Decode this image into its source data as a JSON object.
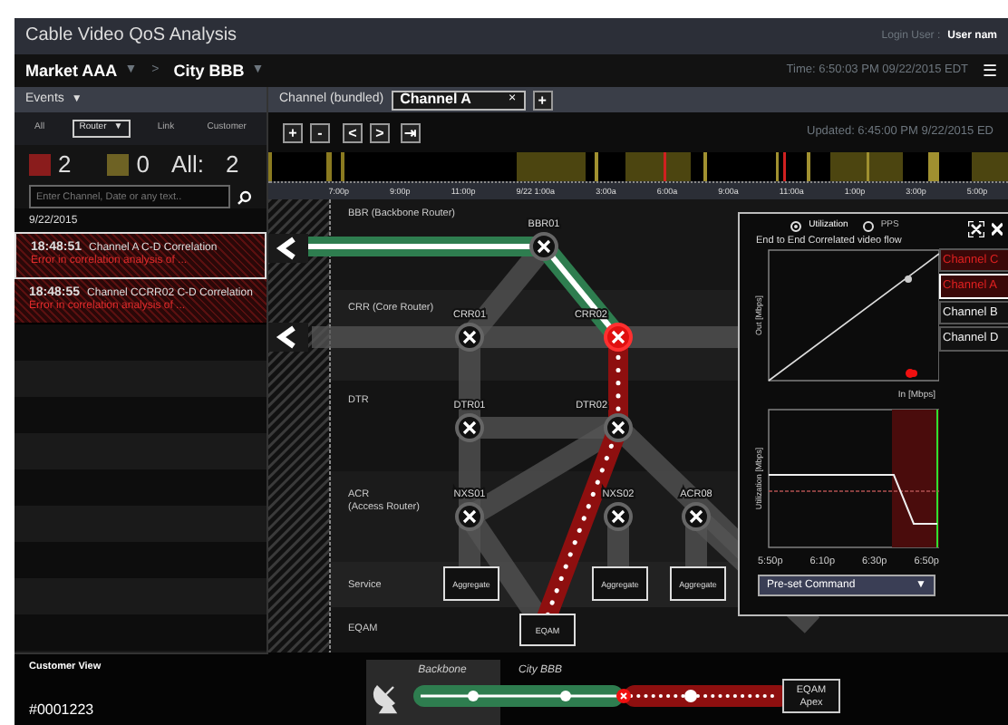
{
  "app_title": "Cable Video QoS Analysis",
  "login": {
    "label": "Login User :",
    "user": "User nam"
  },
  "breadcrumb": [
    {
      "label": "Market AAA",
      "caret": "▼"
    },
    {
      "label": "City BBB",
      "caret": "▼"
    }
  ],
  "breadcrumb_separator": ">",
  "time": "Time: 6:50:03 PM 09/22/2015 EDT",
  "menu_glyph": "☰",
  "events": {
    "title": "Events",
    "caret": "▼",
    "filters": [
      {
        "label": "All",
        "selected": false
      },
      {
        "label": "Router",
        "selected": true,
        "caret": "▼"
      },
      {
        "label": "Link",
        "selected": false
      },
      {
        "label": "Customer",
        "selected": false
      }
    ],
    "counts": [
      {
        "value": "2",
        "color": "#8a1c1c"
      },
      {
        "value": "0",
        "color": "#6e6224"
      }
    ],
    "all_label": "All:",
    "all_value": "2",
    "search": {
      "placeholder": "Enter Channel, Date or any text.."
    },
    "date": "9/22/2015",
    "items": [
      {
        "time": "18:48:51",
        "title": "Channel A C-D Correlation",
        "message": "Error in correlation analysis of ...",
        "selected": true
      },
      {
        "time": "18:48:55",
        "title": "Channel CCRR02 C-D Correlation",
        "message": "Error in correlation analysis of ...",
        "selected": false
      }
    ]
  },
  "channel_bar": {
    "label": "Channel (bundled)",
    "tabs": [
      {
        "label": "Channel A",
        "close": "×",
        "selected": true
      }
    ],
    "add": "+"
  },
  "toolbar": [
    "+",
    "-",
    "<",
    ">",
    "⇥"
  ],
  "updated": "Updated: 6:45:00 PM 9/22/2015 ED",
  "timeline_ticks": [
    "7:00p",
    "9:00p",
    "11:00p",
    "9/22 1:00a",
    "3:00a",
    "6:00a",
    "9:00a",
    "11:00a",
    "1:00p",
    "3:00p",
    "5:00p"
  ],
  "diagram": {
    "layers": [
      {
        "label": "BBR (Backbone Router)"
      },
      {
        "label": "CRR (Core Router)"
      },
      {
        "label": "DTR"
      },
      {
        "label": "ACR\n(Access Router)"
      },
      {
        "label": "Service"
      },
      {
        "label": "EQAM"
      }
    ],
    "nodes": [
      {
        "label": "BBR01",
        "alarm": false
      },
      {
        "label": "CRR01",
        "alarm": false
      },
      {
        "label": "CRR02",
        "alarm": true
      },
      {
        "label": "DTR01",
        "alarm": false
      },
      {
        "label": "DTR02",
        "alarm": false
      },
      {
        "label": "NXS01",
        "alarm": false
      },
      {
        "label": "NXS02",
        "alarm": false
      },
      {
        "label": "ACR08",
        "alarm": false
      }
    ],
    "boxes": [
      "Aggregate",
      "Aggregate",
      "Aggregate",
      "EQAM"
    ]
  },
  "panel": {
    "modes": [
      {
        "label": "Utilization",
        "selected": true
      },
      {
        "label": "PPS",
        "selected": false
      }
    ],
    "title": "End to End Correlated video flow",
    "scatter": {
      "ylabel": "Out [Mbps]",
      "xlabel": "In [Mbps]"
    },
    "utilization": {
      "ylabel": "Utilization [Mbps]",
      "xticks": [
        "5:50p",
        "6:10p",
        "6:30p",
        "6:50p"
      ]
    },
    "command": {
      "value": "Pre-set Command",
      "caret": "▼"
    },
    "channels": [
      {
        "label": "Channel C",
        "alarm": true,
        "selected": false
      },
      {
        "label": "Channel A",
        "alarm": true,
        "selected": true
      },
      {
        "label": "Channel B",
        "alarm": false,
        "selected": false
      },
      {
        "label": "Channel D",
        "alarm": false,
        "selected": false
      }
    ]
  },
  "customer": {
    "title": "Customer View",
    "id": "#0001223",
    "segments": [
      "Backbone",
      "City BBB"
    ],
    "endpoint": "EQAM\nApex"
  }
}
